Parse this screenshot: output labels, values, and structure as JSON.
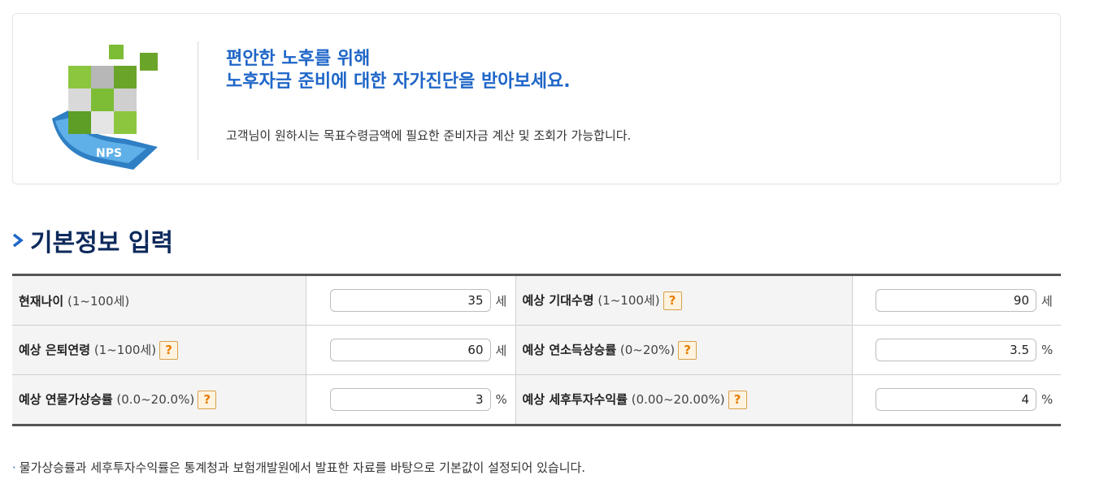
{
  "banner": {
    "headline_line1": "편안한 노후를 위해",
    "headline_line2": "노후자금 준비에 대한 자가진단을 받아보세요.",
    "subtext": "고객님이 원하시는 목표수령금액에 필요한 준비자금 계산 및 조회가 가능합니다.",
    "logo_text": "NPS"
  },
  "section": {
    "title": "기본정보 입력"
  },
  "form": {
    "rows": [
      {
        "left": {
          "label": "현재나이",
          "range": "(1~100세)",
          "value": "35",
          "unit": "세",
          "help": false
        },
        "right": {
          "label": "예상 기대수명",
          "range": "(1~100세)",
          "value": "90",
          "unit": "세",
          "help": true
        }
      },
      {
        "left": {
          "label": "예상 은퇴연령",
          "range": "(1~100세)",
          "value": "60",
          "unit": "세",
          "help": true
        },
        "right": {
          "label": "예상 연소득상승률",
          "range": "(0~20%)",
          "value": "3.5",
          "unit": "%",
          "help": true
        }
      },
      {
        "left": {
          "label": "예상 연물가상승률",
          "range": "(0.0~20.0%)",
          "value": "3",
          "unit": "%",
          "help": true
        },
        "right": {
          "label": "예상 세후투자수익률",
          "range": "(0.00~20.00%)",
          "value": "4",
          "unit": "%",
          "help": true
        }
      }
    ],
    "help_symbol": "?"
  },
  "note": {
    "bullet": "·",
    "text": "물가상승률과 세후투자수익률은 통계청과 보험개발원에서 발표한 자료를 바탕으로 기본값이 설정되어 있습니다."
  },
  "colors": {
    "accent": "#1f66c8",
    "title": "#0e2a5c",
    "help": "#e67e00"
  }
}
